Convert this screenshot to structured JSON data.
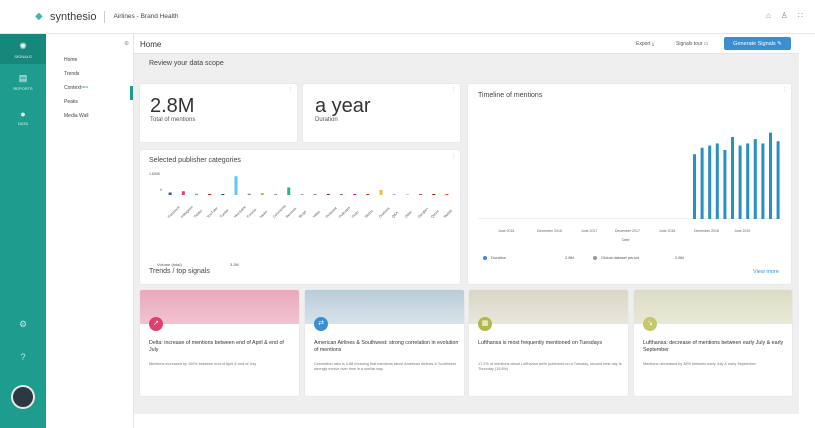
{
  "topbar": {
    "brand": "synthesio",
    "project_title": "Airlines - Brand Health"
  },
  "rail": {
    "items": [
      {
        "label": "SIGNALS",
        "icon": "signals-icon"
      },
      {
        "label": "REPORTS",
        "icon": "reports-icon"
      },
      {
        "label": "DATA",
        "icon": "data-icon"
      }
    ]
  },
  "subnav": {
    "items": [
      {
        "label": "Home"
      },
      {
        "label": "Trends"
      },
      {
        "label": "Context",
        "badge": "NEW"
      },
      {
        "label": "Peaks"
      },
      {
        "label": "Media Wall"
      }
    ]
  },
  "header": {
    "title": "Home",
    "export": "Export",
    "tour": "Signals tour",
    "generate": "Generate Signals"
  },
  "scope": {
    "section_title": "Review your data scope",
    "total_value": "2.8M",
    "total_label": "Total of mentions",
    "duration_value": "a year",
    "duration_label": "Duration"
  },
  "publishers": {
    "title": "Selected publisher categories",
    "y_tick": "1.600K",
    "y_zero": "0",
    "volume_label": "Volume (total)",
    "volume_value": "3.2M"
  },
  "timeline": {
    "title": "Timeline of mentions",
    "x_axis_title": "Date",
    "legend_duration": "Duration",
    "duration_value": "2.8M",
    "legend_global": "Global dataset period",
    "global_value": "2.8M"
  },
  "trends": {
    "section_title": "Trends / top signals",
    "view_more": "View more",
    "cards": [
      {
        "title": "Delta: increase of mentions between end of April & end of July",
        "desc": "Mentions increased by 100% between end of April & end of July",
        "color": "#e0406d"
      },
      {
        "title": "American Airlines & Southwest: strong correlation in evolution of mentions",
        "desc": "Correlation ratio is 0.88 meaning that mentions about American Airlines & Southwest strongly evolve over time in a similar way",
        "color": "#3b8fd1"
      },
      {
        "title": "Lufthansa is most frequently mentioned on Tuesdays",
        "desc": "17.2% of mentions about Lufthansa were published on a Tuesday, second best day is Thursday (15.8%)",
        "color": "#b3b84a"
      },
      {
        "title": "Lufthansa: decrease of mentions between early July & early September",
        "desc": "Mentions decreased by 38% between early July & early September",
        "color": "#c4c86a"
      }
    ]
  },
  "chart_data": [
    {
      "type": "bar",
      "title": "Selected publisher categories",
      "categories": [
        "Facebook",
        "Instagram",
        "Twitter",
        "YouTube",
        "Tumblr",
        "Vkontakte",
        "Forums",
        "News",
        "Comments",
        "Reviews",
        "Blogs",
        "Video",
        "Pinterest",
        "Podcasts",
        "Flickr",
        "Weibo",
        "Ovations",
        "Q&A",
        "Other",
        "Google+",
        "Quora",
        "Reddit"
      ],
      "series": [
        {
          "values": [
            200,
            300,
            100,
            50,
            80,
            1500,
            100,
            150,
            50,
            600,
            50,
            30,
            20,
            20,
            80,
            40,
            400,
            30,
            20,
            30,
            40,
            50
          ]
        }
      ],
      "ylim": [
        0,
        1600
      ]
    },
    {
      "type": "bar",
      "title": "Timeline of mentions",
      "xlabel": "Date",
      "x_ticks": [
        "June 2016",
        "December 2016",
        "June 2017",
        "December 2017",
        "June 2018",
        "December 2018",
        "June 2019"
      ],
      "values": [
        150,
        165,
        170,
        175,
        160,
        190,
        170,
        175,
        185,
        175,
        200,
        180
      ]
    }
  ]
}
